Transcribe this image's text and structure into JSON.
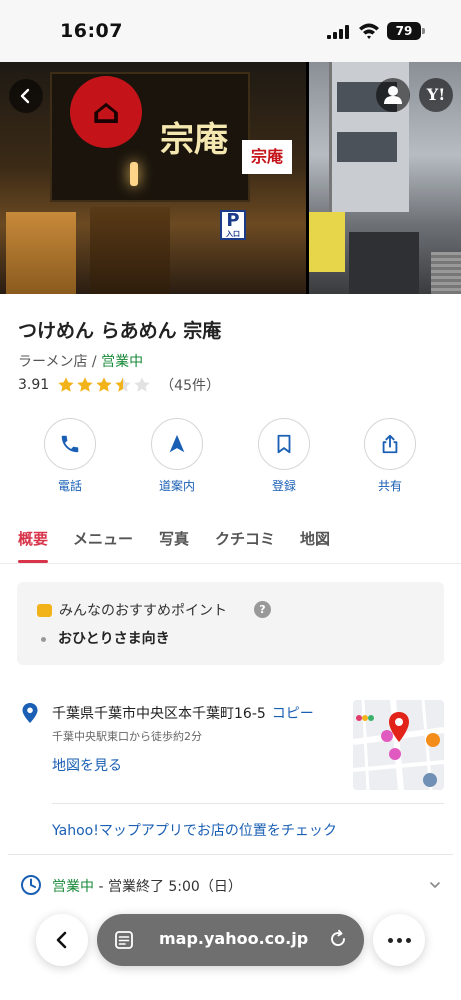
{
  "status_bar": {
    "time": "16:07",
    "battery": "79"
  },
  "photos": {
    "sign_main": "宗庵",
    "lantern_sign": "宗庵",
    "parking_letter": "P",
    "parking_sub": "入口",
    "yahoo_badge": "Y!"
  },
  "shop": {
    "name": "つけめん らあめん 宗庵",
    "category": "ラーメン店",
    "separator": " / ",
    "status": "営業中",
    "rating": "3.91",
    "stars_value": 3.5,
    "review_count": "（45件）"
  },
  "actions": [
    {
      "label": "電話",
      "icon": "phone-icon"
    },
    {
      "label": "道案内",
      "icon": "navigate-icon"
    },
    {
      "label": "登録",
      "icon": "bookmark-icon"
    },
    {
      "label": "共有",
      "icon": "share-icon"
    }
  ],
  "tabs": [
    {
      "label": "概要",
      "active": true
    },
    {
      "label": "メニュー"
    },
    {
      "label": "写真"
    },
    {
      "label": "クチコミ"
    },
    {
      "label": "地図"
    }
  ],
  "recommend": {
    "heading": "みんなのおすすめポイント",
    "help": "?",
    "item": "おひとりさま向き"
  },
  "address": {
    "text": "千葉県千葉市中央区本千葉町16-5",
    "copy": "コピー",
    "walk": "千葉中央駅東口から徒歩約2分",
    "map_link": "地図を見る"
  },
  "app_link": "Yahoo!マップアプリでお店の位置をチェック",
  "hours": {
    "status": "営業中",
    "detail": " - 営業終了 5:00（日）"
  },
  "browser": {
    "url": "map.yahoo.co.jp"
  },
  "colors": {
    "accent_red": "#d8344a",
    "link_blue": "#1a5fb4",
    "open_green": "#1a8a3a",
    "star_yellow": "#f2b21a"
  }
}
